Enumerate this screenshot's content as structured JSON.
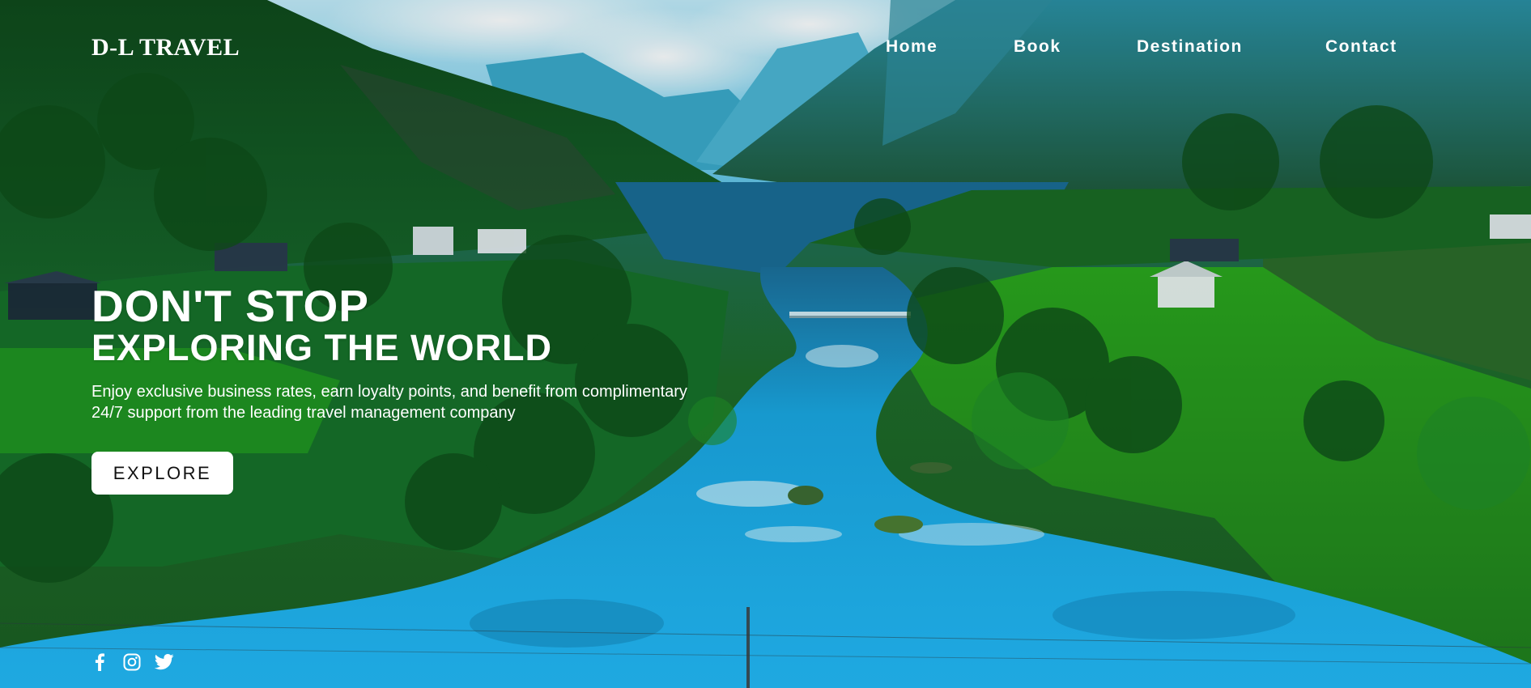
{
  "brand": {
    "logo_text": "D-L TRAVEL"
  },
  "nav": {
    "items": [
      {
        "label": "Home"
      },
      {
        "label": "Book"
      },
      {
        "label": "Destination"
      },
      {
        "label": "Contact"
      }
    ]
  },
  "hero": {
    "headline_line1": "DON'T STOP",
    "headline_line2": "EXPLORING THE WORLD",
    "subtext": "Enjoy exclusive business rates, earn loyalty points, and benefit from complimentary 24/7 support from the leading travel management company",
    "cta_label": "EXPLORE"
  },
  "social": {
    "icons": [
      "facebook-icon",
      "instagram-icon",
      "twitter-icon"
    ]
  },
  "colors": {
    "text": "#ffffff",
    "button_bg": "#ffffff",
    "button_text": "#111111",
    "river": "#1fb3f0",
    "foliage": "#1f7a26",
    "sky": "#7fd3f2"
  }
}
